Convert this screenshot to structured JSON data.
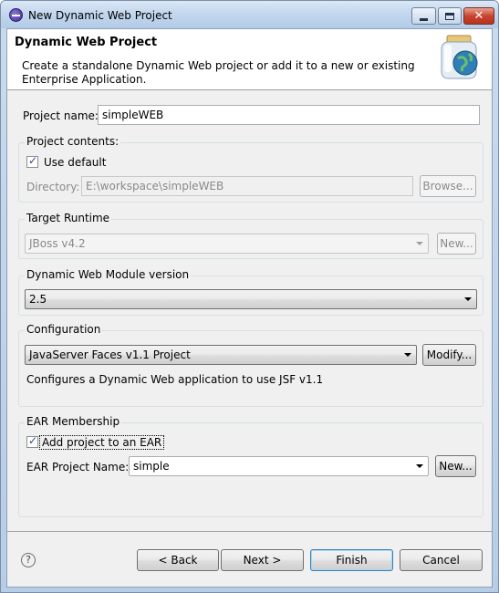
{
  "window": {
    "title": "New Dynamic Web Project"
  },
  "header": {
    "title": "Dynamic Web Project",
    "description": "Create a standalone Dynamic Web project or add it to a new or existing Enterprise Application."
  },
  "project_name": {
    "label": "Project name:",
    "value": "simpleWEB"
  },
  "project_contents": {
    "group_label": "Project contents:",
    "use_default_label": "Use default",
    "use_default_checked": true,
    "directory_label": "Directory:",
    "directory_value": "E:\\workspace\\simpleWEB",
    "browse_label": "Browse..."
  },
  "target_runtime": {
    "group_label": "Target Runtime",
    "value": "JBoss v4.2",
    "new_label": "New..."
  },
  "module_version": {
    "group_label": "Dynamic Web Module version",
    "value": "2.5"
  },
  "configuration": {
    "group_label": "Configuration",
    "value": "JavaServer Faces v1.1 Project",
    "modify_label": "Modify...",
    "description": "Configures a Dynamic Web application to use JSF v1.1"
  },
  "ear": {
    "group_label": "EAR Membership",
    "add_label": "Add project to an EAR",
    "add_checked": true,
    "project_name_label": "EAR Project Name:",
    "project_name_value": "simple",
    "new_label": "New..."
  },
  "footer": {
    "back_label": "< Back",
    "next_label": "Next >",
    "finish_label": "Finish",
    "cancel_label": "Cancel"
  }
}
